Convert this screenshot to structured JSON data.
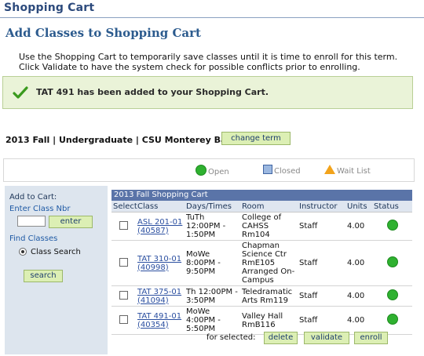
{
  "header": {
    "title": "Shopping Cart"
  },
  "page": {
    "title": "Add Classes to Shopping Cart",
    "instructions_line1": "Use the Shopping Cart to temporarily save classes until it is time to enroll for this term.",
    "instructions_line2": "Click Validate to have the system check for possible conflicts prior to enrolling."
  },
  "success": {
    "message": "TAT  491 has been added to your Shopping Cart.",
    "icon": "checkmark-icon",
    "color": "#3a9a1e"
  },
  "term": {
    "label": "2013 Fall | Undergraduate | CSU Monterey Bay",
    "change_button": "change term"
  },
  "legend": {
    "open": "Open",
    "closed": "Closed",
    "wait_list": "Wait List"
  },
  "add_to_cart": {
    "heading": "Add to Cart:",
    "enter_class_nbr": "Enter Class Nbr",
    "input_value": "",
    "enter_button": "enter",
    "find_classes": "Find Classes",
    "class_search": "Class Search",
    "search_button": "search"
  },
  "cart": {
    "title": "2013 Fall Shopping Cart",
    "columns": [
      "Select",
      "Class",
      "Days/Times",
      "Room",
      "Instructor",
      "Units",
      "Status"
    ],
    "rows": [
      {
        "class": "ASL 201-01 (40587)",
        "days_times": "TuTh 12:00PM - 1:50PM",
        "room": "College of CAHSS Rm104",
        "instructor": "Staff",
        "units": "4.00",
        "status": "Open"
      },
      {
        "class": "TAT 310-01 (40998)",
        "days_times": "MoWe 8:00PM - 9:50PM",
        "room": "Chapman Science Ctr RmE105 Arranged On-Campus",
        "instructor": "Staff",
        "units": "4.00",
        "status": "Open"
      },
      {
        "class": "TAT 375-01 (41094)",
        "days_times": "Th 12:00PM - 3:50PM",
        "room": "Teledramatic Arts Rm119",
        "instructor": "Staff",
        "units": "4.00",
        "status": "Open"
      },
      {
        "class": "TAT 491-01 (40354)",
        "days_times": "MoWe 4:00PM - 5:50PM",
        "room": "Valley Hall RmB116",
        "instructor": "Staff",
        "units": "4.00",
        "status": "Open"
      }
    ],
    "for_selected": "for selected:",
    "delete_button": "delete",
    "validate_button": "validate",
    "enroll_button": "enroll"
  },
  "colors": {
    "accent": "#2c5b8e",
    "button_bg": "#dcefb4",
    "open_green": "#2fb130",
    "header_bar": "#5a74a8"
  }
}
